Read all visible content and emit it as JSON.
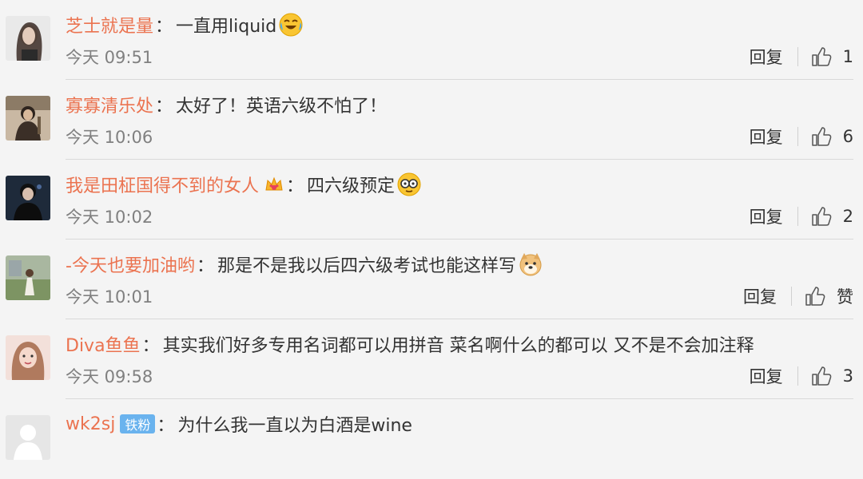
{
  "comments": [
    {
      "username": "芝士就是量",
      "colon": "：",
      "content": "一直用liquid",
      "time": "今天 09:51",
      "reply": "回复",
      "likes": "1"
    },
    {
      "username": "寡寡清乐处",
      "colon": "：",
      "content": "太好了！英语六级不怕了！",
      "time": "今天 10:06",
      "reply": "回复",
      "likes": "6"
    },
    {
      "username": "我是田柾国得不到的女人",
      "colon": "：",
      "content": "四六级预定",
      "time": "今天 10:02",
      "reply": "回复",
      "likes": "2"
    },
    {
      "username": "-今天也要加油哟",
      "colon": "：",
      "content": "那是不是我以后四六级考试也能这样写",
      "time": "今天 10:01",
      "reply": "回复",
      "likes": "赞"
    },
    {
      "username": "Diva鱼鱼",
      "colon": "：",
      "content": "其实我们好多专用名词都可以用拼音 菜名啊什么的都可以 又不是不会加注释",
      "time": "今天 09:58",
      "reply": "回复",
      "likes": "3"
    },
    {
      "username": "wk2sj",
      "badge": "铁粉",
      "colon": "：",
      "content": "为什么我一直以为白酒是wine"
    }
  ],
  "colors": {
    "username": "#eb7350",
    "time": "#808080",
    "divider": "#d9d9d9",
    "badge": "#6ab3ee"
  }
}
